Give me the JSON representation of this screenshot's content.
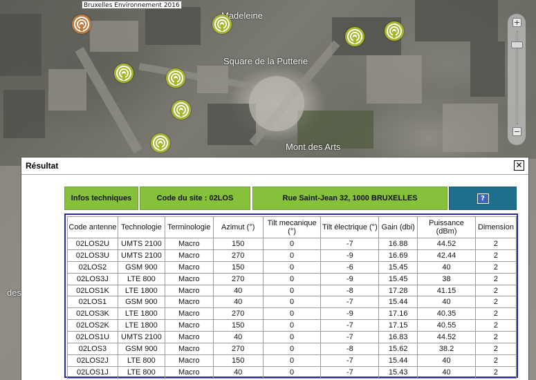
{
  "map": {
    "credit": "Bruxelles Environnement 2016",
    "labels": {
      "madeleine": "Madeleine",
      "square": "Square de la Putterie",
      "mont_des_arts": "Mont des Arts",
      "left_fragment": "des"
    },
    "marker_colors": {
      "normal": "#a9b629",
      "selected": "#c07a3c"
    },
    "zoom": {
      "plus": "+",
      "minus": "−"
    }
  },
  "dialog": {
    "title": "Résultat",
    "close_label": "✕",
    "header": {
      "infos": "Infos techniques",
      "site": "Code du site : 02LOS",
      "address": "Rue Saint-Jean 32, 1000 BRUXELLES",
      "help": "?"
    },
    "colors": {
      "green": "#86c13b",
      "blue": "#1e6f8e",
      "table_border": "#2a2a9e"
    },
    "table": {
      "columns": [
        "Code antenne",
        "Technologie",
        "Terminologie",
        "Azimut (°)",
        "Tilt mecanique (°)",
        "Tilt électrique (°)",
        "Gain (dbi)",
        "Puissance (dBm)",
        "Dimension"
      ],
      "rows": [
        [
          "02LOS2U",
          "UMTS 2100",
          "Macro",
          "150",
          "0",
          "-7",
          "16.88",
          "44.52",
          "2"
        ],
        [
          "02LOS3U",
          "UMTS 2100",
          "Macro",
          "270",
          "0",
          "-9",
          "16.69",
          "42.44",
          "2"
        ],
        [
          "02LOS2",
          "GSM 900",
          "Macro",
          "150",
          "0",
          "-6",
          "15.45",
          "40",
          "2"
        ],
        [
          "02LOS3J",
          "LTE 800",
          "Macro",
          "270",
          "0",
          "-9",
          "15.45",
          "38",
          "2"
        ],
        [
          "02LOS1K",
          "LTE 1800",
          "Macro",
          "40",
          "0",
          "-8",
          "17.28",
          "41.15",
          "2"
        ],
        [
          "02LOS1",
          "GSM 900",
          "Macro",
          "40",
          "0",
          "-7",
          "15.44",
          "40",
          "2"
        ],
        [
          "02LOS3K",
          "LTE 1800",
          "Macro",
          "270",
          "0",
          "-9",
          "17.16",
          "40.35",
          "2"
        ],
        [
          "02LOS2K",
          "LTE 1800",
          "Macro",
          "150",
          "0",
          "-7",
          "17.15",
          "40.55",
          "2"
        ],
        [
          "02LOS1U",
          "UMTS 2100",
          "Macro",
          "40",
          "0",
          "-7",
          "16.83",
          "44.52",
          "2"
        ],
        [
          "02LOS3",
          "GSM 900",
          "Macro",
          "270",
          "0",
          "-8",
          "15.62",
          "38.2",
          "2"
        ],
        [
          "02LOS2J",
          "LTE 800",
          "Macro",
          "150",
          "0",
          "-7",
          "15.44",
          "40",
          "2"
        ],
        [
          "02LOS1J",
          "LTE 800",
          "Macro",
          "40",
          "0",
          "-7",
          "15.43",
          "40",
          "2"
        ]
      ]
    }
  }
}
